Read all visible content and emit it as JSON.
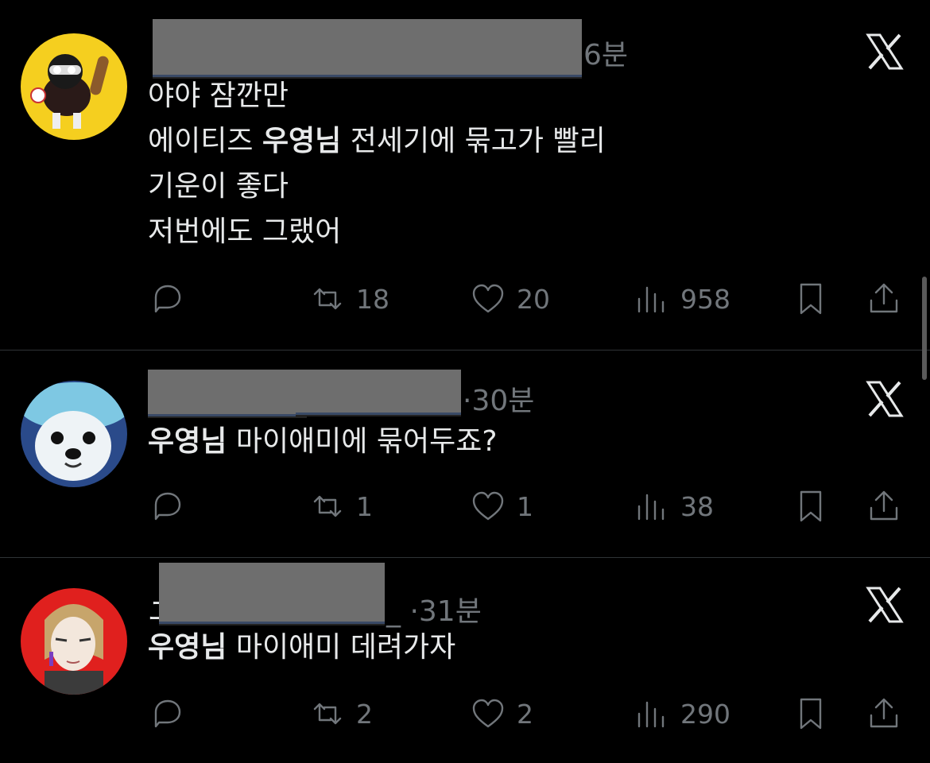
{
  "tweets": [
    {
      "time": "6분",
      "lines": [
        {
          "bold": "",
          "text": "야야 잠깐만"
        },
        {
          "pre": "에이티즈 ",
          "bold": "우영님",
          "text": " 전세기에 묶고가 빨리"
        },
        {
          "bold": "",
          "text": "기운이 좋다"
        },
        {
          "bold": "",
          "text": "저번에도 그랬어"
        }
      ],
      "retweets": "18",
      "likes": "20",
      "views": "958"
    },
    {
      "time": "·30분",
      "lines": [
        {
          "bold": "우영님",
          "text": " 마이애미에 묶어두죠?"
        }
      ],
      "retweets": "1",
      "likes": "1",
      "views": "38"
    },
    {
      "time": "_ ·31분",
      "name_prefix": "ユ",
      "lines": [
        {
          "bold": "우영님",
          "text": " 마이애미 데려가자"
        }
      ],
      "retweets": "2",
      "likes": "2",
      "views": "290"
    }
  ],
  "icons": {
    "reply": "reply-icon",
    "retweet": "retweet-icon",
    "like": "heart-icon",
    "views": "views-icon",
    "bookmark": "bookmark-icon",
    "share": "share-icon",
    "brand": "x-logo-icon"
  },
  "colors": {
    "background": "#000000",
    "text": "#e7e9ea",
    "muted": "#71767b",
    "divider": "#2f3336"
  }
}
